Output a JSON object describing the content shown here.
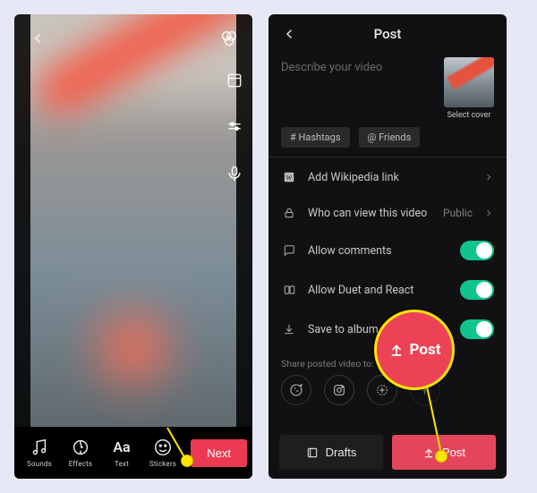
{
  "edit": {
    "tools": {
      "sounds": "Sounds",
      "effects": "Effects",
      "text": "Text",
      "stickers": "Stickers"
    },
    "next_label": "Next"
  },
  "post": {
    "title": "Post",
    "describe_placeholder": "Describe your video",
    "select_cover": "Select cover",
    "chip_hashtags": "# Hashtags",
    "chip_friends": "@ Friends",
    "wiki_label": "Add Wikipedia link",
    "privacy_label": "Who can view this video",
    "privacy_value": "Public",
    "comments_label": "Allow comments",
    "duet_label": "Allow Duet and React",
    "save_label": "Save to album",
    "share_label": "Share posted video to:",
    "drafts_label": "Drafts",
    "post_label": "Post",
    "callout_label": "Post"
  }
}
